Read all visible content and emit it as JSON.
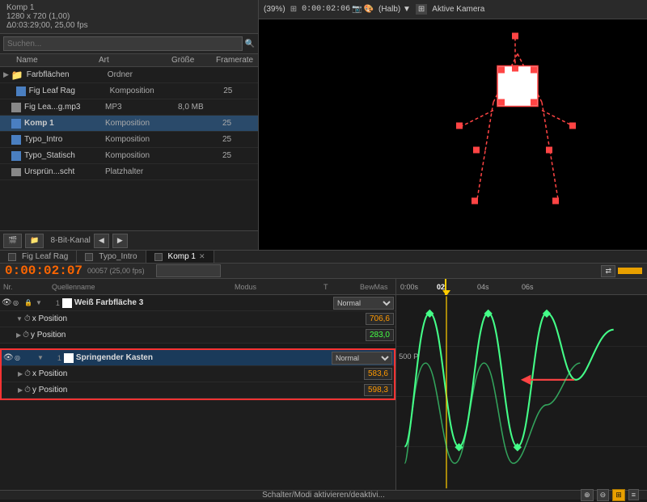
{
  "project": {
    "info_line1": "Komp 1",
    "info_line2": "1280 x 720 (1,00)",
    "info_line3": "Δ0:03:29;00, 25,00 fps"
  },
  "search": {
    "placeholder": "Suchen..."
  },
  "file_list": {
    "headers": [
      "Name",
      "Art",
      "Größe",
      "Framerate"
    ],
    "items": [
      {
        "name": "Farbflächen",
        "type": "Ordner",
        "size": "",
        "fps": "",
        "indent": 0,
        "folder": true,
        "color": "#f0c040"
      },
      {
        "name": "Fig Leaf Rag",
        "type": "Komposition",
        "size": "",
        "fps": "25",
        "indent": 1,
        "color": "#4a7fc1"
      },
      {
        "name": "Fig Lea...g.mp3",
        "type": "MP3",
        "size": "8,0 MB",
        "fps": "",
        "indent": 0,
        "color": "#888888"
      },
      {
        "name": "Komp 1",
        "type": "Komposition",
        "size": "",
        "fps": "25",
        "indent": 0,
        "selected": true,
        "color": "#4a7fc1"
      },
      {
        "name": "Typo_Intro",
        "type": "Komposition",
        "size": "",
        "fps": "25",
        "indent": 0,
        "color": "#4a7fc1"
      },
      {
        "name": "Typo_Statisch",
        "type": "Komposition",
        "size": "",
        "fps": "25",
        "indent": 0,
        "color": "#4a7fc1"
      },
      {
        "name": "Ursprün...scht",
        "type": "Platzhalter",
        "size": "",
        "fps": "",
        "indent": 0,
        "color": "#888888"
      }
    ]
  },
  "preview": {
    "zoom": "(39%)",
    "resolution": "(Halb)",
    "timecode": "0:00:02:06",
    "camera": "Aktive Kamera"
  },
  "tabs": [
    {
      "label": "Fig Leaf Rag",
      "active": false
    },
    {
      "label": "Typo_Intro",
      "active": false
    },
    {
      "label": "Komp 1",
      "active": true
    }
  ],
  "timeline": {
    "timecode": "0:00:02:07",
    "fps_info": "00057 (25,00 fps)",
    "ruler_marks": [
      "0:00s",
      "02",
      "04s",
      "06s"
    ]
  },
  "layers": {
    "header_cols": [
      "Nr.",
      "Quellenname",
      "Modus",
      "T",
      "BewMas"
    ],
    "layer1": {
      "num": "1",
      "name": "Weiß Farbfläche 3",
      "mode": "Normal",
      "color": "#ffffff",
      "sub1": {
        "name": "x Position",
        "value": "706,6",
        "value_color": "orange"
      },
      "sub2": {
        "name": "y Position",
        "value": "283,0",
        "value_color": "green"
      }
    },
    "layer2": {
      "num": "1",
      "name": "Springender Kasten",
      "mode": "Normal",
      "color": "#ffffff",
      "sub1": {
        "name": "x Position",
        "value": "583,6",
        "value_color": "orange"
      },
      "sub2": {
        "name": "y Position",
        "value": "598,3",
        "value_color": "orange"
      }
    }
  },
  "bottom_bar": {
    "label": "Schalter/Modi aktivieren/deaktivi..."
  },
  "toolbar": {
    "bit_depth": "8-Bit-Kanal",
    "mode_label": "Normal"
  }
}
